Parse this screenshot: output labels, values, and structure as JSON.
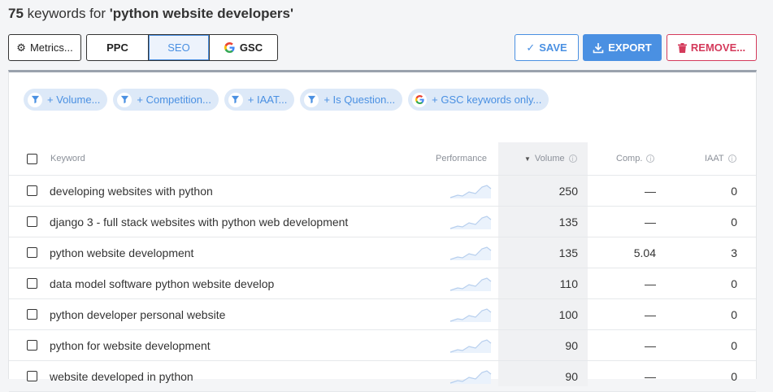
{
  "header": {
    "count": "75",
    "middle": " keywords for ",
    "query": "'python website developers'"
  },
  "toolbar": {
    "metrics_label": "Metrics...",
    "ppc_label": "PPC",
    "seo_label": "SEO",
    "gsc_label": "GSC",
    "save_label": "SAVE",
    "export_label": "EXPORT",
    "remove_label": "REMOVE..."
  },
  "filters": [
    {
      "label": "+ Volume...",
      "icon": "filter-icon"
    },
    {
      "label": "+ Competition...",
      "icon": "filter-icon"
    },
    {
      "label": "+ IAAT...",
      "icon": "filter-icon"
    },
    {
      "label": "+ Is Question...",
      "icon": "filter-icon"
    },
    {
      "label": "+ GSC keywords only...",
      "icon": "google-icon"
    }
  ],
  "table": {
    "headers": {
      "keyword": "Keyword",
      "performance": "Performance",
      "volume": "Volume",
      "comp": "Comp.",
      "iaat": "IAAT"
    },
    "rows": [
      {
        "keyword": "developing websites with python",
        "volume": "250",
        "comp": "—",
        "iaat": "0"
      },
      {
        "keyword": "django 3 - full stack websites with python web development",
        "volume": "135",
        "comp": "—",
        "iaat": "0"
      },
      {
        "keyword": "python website development",
        "volume": "135",
        "comp": "5.04",
        "iaat": "3"
      },
      {
        "keyword": "data model software python website develop",
        "volume": "110",
        "comp": "—",
        "iaat": "0"
      },
      {
        "keyword": "python developer personal website",
        "volume": "100",
        "comp": "—",
        "iaat": "0"
      },
      {
        "keyword": "python for website development",
        "volume": "90",
        "comp": "—",
        "iaat": "0"
      },
      {
        "keyword": "website developed in python",
        "volume": "90",
        "comp": "—",
        "iaat": "0"
      }
    ]
  },
  "colors": {
    "accent": "#4a90e2",
    "danger": "#d43a5b",
    "chip_bg": "#dde9f8"
  }
}
